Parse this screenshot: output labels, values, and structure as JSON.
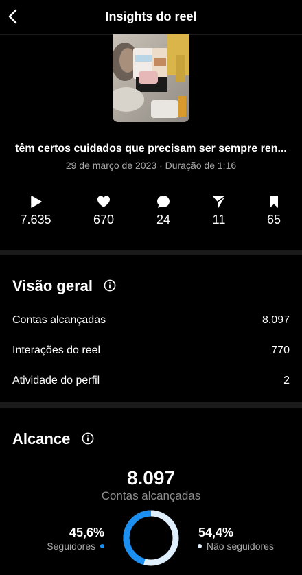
{
  "header": {
    "title": "Insights do reel"
  },
  "reel": {
    "caption": "têm certos cuidados que precisam ser sempre ren...",
    "date": "29 de março de 2023",
    "separator": "·",
    "duration": "Duração de 1:16"
  },
  "stats": [
    {
      "icon": "play-icon",
      "value": "7.635"
    },
    {
      "icon": "heart-icon",
      "value": "670"
    },
    {
      "icon": "comment-icon",
      "value": "24"
    },
    {
      "icon": "share-icon",
      "value": "11"
    },
    {
      "icon": "bookmark-icon",
      "value": "65"
    }
  ],
  "overview": {
    "title": "Visão geral",
    "rows": [
      {
        "label": "Contas alcançadas",
        "value": "8.097"
      },
      {
        "label": "Interações do reel",
        "value": "770"
      },
      {
        "label": "Atividade do perfil",
        "value": "2"
      }
    ]
  },
  "reach": {
    "title": "Alcance",
    "total": "8.097",
    "total_label": "Contas alcançadas",
    "followers_pct": "45,6%",
    "followers_label": "Seguidores",
    "non_followers_pct": "54,4%",
    "non_followers_label": "Não seguidores",
    "followers_fraction": 0.456
  },
  "colors": {
    "followers": "#1b8ff2",
    "non_followers": "#dfeefb",
    "muted": "#a8a8a8"
  }
}
